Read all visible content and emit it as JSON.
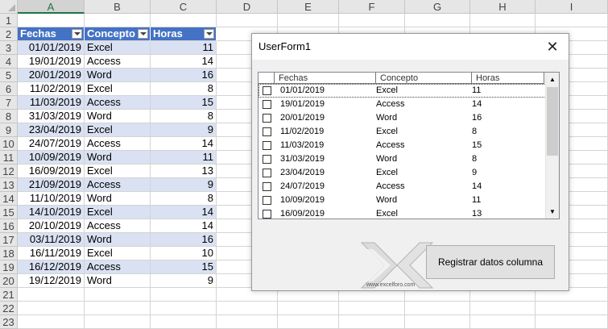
{
  "sheet": {
    "columns": [
      "A",
      "B",
      "C",
      "D",
      "E",
      "F",
      "G",
      "H",
      "I"
    ],
    "selected_column": "A",
    "rows": [
      "1",
      "2",
      "3",
      "4",
      "5",
      "6",
      "7",
      "8",
      "9",
      "10",
      "11",
      "12",
      "13",
      "14",
      "15",
      "16",
      "17",
      "18",
      "19",
      "20",
      "21",
      "22",
      "23"
    ],
    "table_headers": [
      "Fechas",
      "Concepto",
      "Horas"
    ],
    "table_rows": [
      [
        "01/01/2019",
        "Excel",
        "11"
      ],
      [
        "19/01/2019",
        "Access",
        "14"
      ],
      [
        "20/01/2019",
        "Word",
        "16"
      ],
      [
        "11/02/2019",
        "Excel",
        "8"
      ],
      [
        "11/03/2019",
        "Access",
        "15"
      ],
      [
        "31/03/2019",
        "Word",
        "8"
      ],
      [
        "23/04/2019",
        "Excel",
        "9"
      ],
      [
        "24/07/2019",
        "Access",
        "14"
      ],
      [
        "10/09/2019",
        "Word",
        "11"
      ],
      [
        "16/09/2019",
        "Excel",
        "13"
      ],
      [
        "21/09/2019",
        "Access",
        "9"
      ],
      [
        "11/10/2019",
        "Word",
        "8"
      ],
      [
        "14/10/2019",
        "Excel",
        "14"
      ],
      [
        "20/10/2019",
        "Access",
        "14"
      ],
      [
        "03/11/2019",
        "Word",
        "16"
      ],
      [
        "16/11/2019",
        "Excel",
        "10"
      ],
      [
        "16/12/2019",
        "Access",
        "15"
      ],
      [
        "19/12/2019",
        "Word",
        "9"
      ]
    ],
    "colors": {
      "header_fill": "#4472c4",
      "band_fill": "#d9e1f2",
      "accent": "#217346"
    }
  },
  "userform": {
    "title": "UserForm1",
    "close_icon": "close-icon",
    "list_headers": [
      "Fechas",
      "Concepto",
      "Horas"
    ],
    "list_rows": [
      [
        "01/01/2019",
        "Excel",
        "11"
      ],
      [
        "19/01/2019",
        "Access",
        "14"
      ],
      [
        "20/01/2019",
        "Word",
        "16"
      ],
      [
        "11/02/2019",
        "Excel",
        "8"
      ],
      [
        "11/03/2019",
        "Access",
        "15"
      ],
      [
        "31/03/2019",
        "Word",
        "8"
      ],
      [
        "23/04/2019",
        "Excel",
        "9"
      ],
      [
        "24/07/2019",
        "Access",
        "14"
      ],
      [
        "10/09/2019",
        "Word",
        "11"
      ],
      [
        "16/09/2019",
        "Excel",
        "13"
      ]
    ],
    "logo_text": "www.excelforo.com",
    "register_button_label": "Registrar datos columna"
  }
}
